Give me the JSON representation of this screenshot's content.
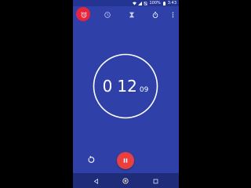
{
  "status_bar": {
    "battery_percent": "100%",
    "time": "3:43",
    "icons": [
      "wifi-icon",
      "signal-icon",
      "no-sim-icon",
      "battery-icon"
    ]
  },
  "tabs": [
    {
      "name": "alarm",
      "icon": "alarm-icon",
      "pressed": true
    },
    {
      "name": "clock",
      "icon": "clock-icon",
      "pressed": false
    },
    {
      "name": "timer",
      "icon": "hourglass-icon",
      "pressed": false
    },
    {
      "name": "stopwatch",
      "icon": "stopwatch-icon",
      "pressed": false
    }
  ],
  "overflow_menu": {
    "icon": "more-vert-icon"
  },
  "timer": {
    "minutes": "0",
    "seconds": "12",
    "hundredths": "09"
  },
  "controls": {
    "reset_icon": "reset-icon",
    "pause_icon": "pause-icon"
  },
  "navigation": {
    "icons": [
      "back-icon",
      "home-icon",
      "recents-icon"
    ]
  },
  "colors": {
    "background": "#2f41a8",
    "status_bar": "#243492",
    "nav_bar": "#1f2c7a",
    "accent": "#e84040",
    "touch_highlight": "#e8243c",
    "foreground": "#ffffff"
  }
}
